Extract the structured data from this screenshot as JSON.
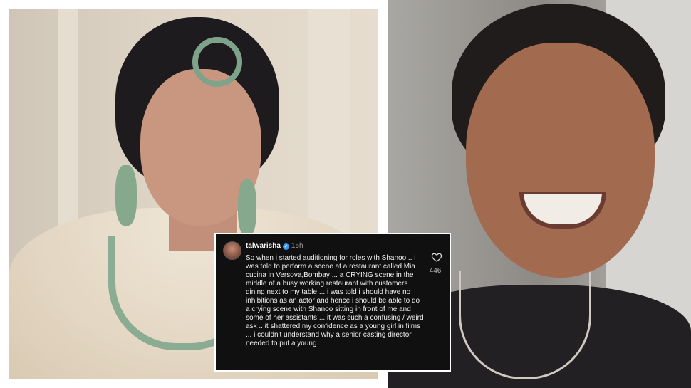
{
  "comment": {
    "username": "talwarisha",
    "verified_icon": "verified-badge-icon",
    "time": "15h",
    "body": "So when i started auditioning for roles with Shanoo...  i was told to perform a scene at a restaurant called Mia cucina in Versova,Bombay ... a CRYING scene in the middle of a busy working restaurant with customers dining next to my table ... i was told i should have no inhibitions as an actor and hence i should be able to do a crying scene with Shanoo sitting in front of me and some of her assistants ... it was such a confusing / weird ask .. it shattered my confidence as a young girl in films ... i couldn't understand why a senior casting director needed to put a young",
    "like_icon": "heart-icon",
    "likes": "446"
  },
  "colors": {
    "comment_background": "#101010",
    "verified_blue": "#3897f0"
  }
}
